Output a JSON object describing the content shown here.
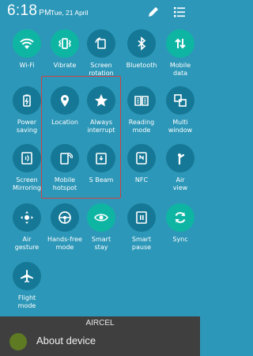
{
  "status": {
    "time": "6:18",
    "period": "PM",
    "date": "Tue, 21 April"
  },
  "tiles": [
    {
      "label": "Wi-Fi",
      "icon": "wifi-icon",
      "state": "on"
    },
    {
      "label": "Vibrate",
      "icon": "vibrate-icon",
      "state": "on"
    },
    {
      "label": "Screen\nrotation",
      "icon": "screen-rotation-icon",
      "state": "off"
    },
    {
      "label": "Bluetooth",
      "icon": "bluetooth-icon",
      "state": "off"
    },
    {
      "label": "Mobile\ndata",
      "icon": "mobile-data-icon",
      "state": "on"
    },
    {
      "label": "Power\nsaving",
      "icon": "power-saving-icon",
      "state": "off"
    },
    {
      "label": "Location",
      "icon": "location-icon",
      "state": "off"
    },
    {
      "label": "Always\ninterrupt",
      "icon": "star-icon",
      "state": "off"
    },
    {
      "label": "Reading\nmode",
      "icon": "reading-mode-icon",
      "state": "off"
    },
    {
      "label": "Multi\nwindow",
      "icon": "multi-window-icon",
      "state": "off"
    },
    {
      "label": "Screen\nMirroring",
      "icon": "screen-mirroring-icon",
      "state": "off"
    },
    {
      "label": "Mobile\nhotspot",
      "icon": "mobile-hotspot-icon",
      "state": "off"
    },
    {
      "label": "S Beam",
      "icon": "s-beam-icon",
      "state": "off"
    },
    {
      "label": "NFC",
      "icon": "nfc-icon",
      "state": "off"
    },
    {
      "label": "Air\nview",
      "icon": "air-view-icon",
      "state": "off"
    },
    {
      "label": "Air\ngesture",
      "icon": "air-gesture-icon",
      "state": "off"
    },
    {
      "label": "Hands-free\nmode",
      "icon": "hands-free-icon",
      "state": "off"
    },
    {
      "label": "Smart\nstay",
      "icon": "smart-stay-icon",
      "state": "on"
    },
    {
      "label": "Smart\npause",
      "icon": "smart-pause-icon",
      "state": "off"
    },
    {
      "label": "Sync",
      "icon": "sync-icon",
      "state": "on"
    },
    {
      "label": "Flight\nmode",
      "icon": "flight-mode-icon",
      "state": "off"
    }
  ],
  "carrier": "AIRCEL",
  "about": {
    "label": "About device"
  },
  "colors": {
    "background": "#2c97b8",
    "tile_on": "#0fb5a3",
    "tile_off": "#157896",
    "highlight": "#d04343"
  }
}
